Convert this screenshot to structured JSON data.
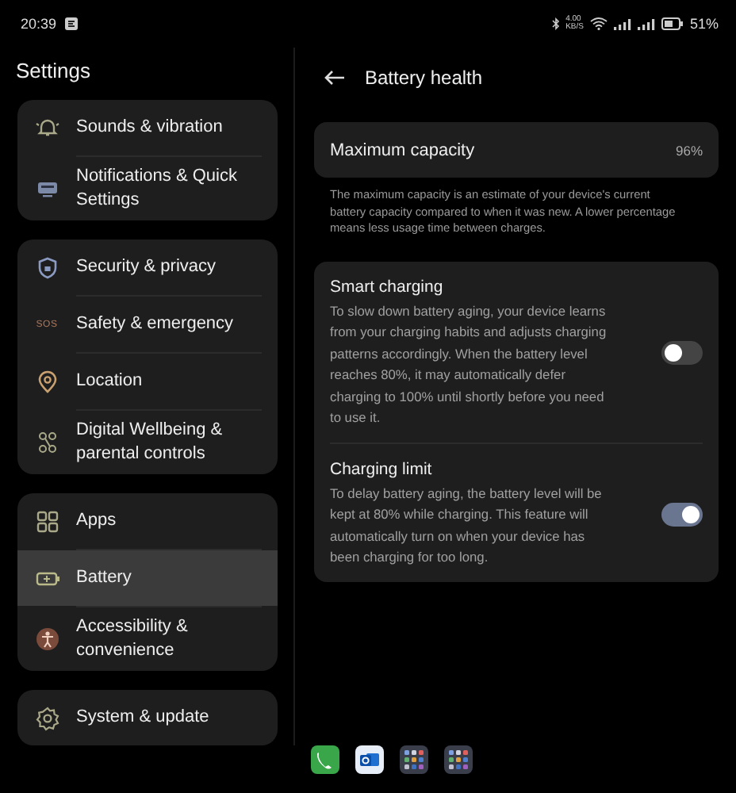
{
  "status_bar": {
    "time": "20:39",
    "net_speed": "4.00",
    "net_unit": "KB/S",
    "battery": "51%"
  },
  "sidebar": {
    "title": "Settings",
    "groups": [
      {
        "items": [
          {
            "label": "Sounds & vibration",
            "kind": "bell",
            "selected": false
          },
          {
            "label": "Notifications & Quick Settings",
            "kind": "notif",
            "selected": false
          }
        ]
      },
      {
        "items": [
          {
            "label": "Security & privacy",
            "kind": "shield",
            "selected": false
          },
          {
            "label": "Safety & emergency",
            "kind": "sos",
            "icon_text": "SOS",
            "selected": false
          },
          {
            "label": "Location",
            "kind": "pin",
            "selected": false
          },
          {
            "label": "Digital Wellbeing & parental controls",
            "kind": "wellbeing",
            "selected": false
          }
        ]
      },
      {
        "items": [
          {
            "label": "Apps",
            "kind": "apps",
            "selected": false
          },
          {
            "label": "Battery",
            "kind": "battery",
            "selected": true
          },
          {
            "label": "Accessibility & convenience",
            "kind": "person",
            "selected": false
          }
        ]
      },
      {
        "items": [
          {
            "label": "System & update",
            "kind": "gear",
            "selected": false
          }
        ]
      }
    ]
  },
  "page": {
    "title": "Battery health",
    "capacity": {
      "label": "Maximum capacity",
      "value": "96%"
    },
    "capacity_note": "The maximum capacity is an estimate of your device's current battery capacity compared to when it was new. A lower percentage means less usage time between charges.",
    "options": [
      {
        "title": "Smart charging",
        "description": "To slow down battery aging, your device learns from your charging habits and adjusts charging patterns accordingly. When the battery level reaches 80%, it may automatically defer charging to 100% until shortly before you need to use it.",
        "on": false
      },
      {
        "title": "Charging limit",
        "description": "To delay battery aging, the battery level will be kept at 80% while charging. This feature will automatically turn on when your device has been charging for too long.",
        "on": true
      }
    ]
  },
  "dock": [
    {
      "kind": "phone"
    },
    {
      "kind": "mail"
    },
    {
      "kind": "folder"
    },
    {
      "kind": "folder"
    }
  ]
}
